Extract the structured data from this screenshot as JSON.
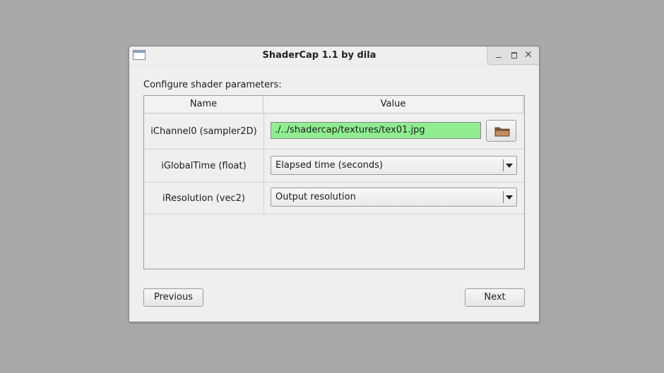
{
  "window": {
    "title": "ShaderCap 1.1 by dila",
    "close_glyph": "✕"
  },
  "main": {
    "instruction": "Configure shader parameters:",
    "table": {
      "headers": [
        "Name",
        "Value"
      ],
      "rows": [
        {
          "name": "iChannel0 (sampler2D)",
          "value": "./../shadercap/textures/tex01.jpg",
          "control": "file-path"
        },
        {
          "name": "iGlobalTime (float)",
          "value": "Elapsed time (seconds)",
          "control": "dropdown"
        },
        {
          "name": "iResolution (vec2)",
          "value": "Output resolution",
          "control": "dropdown"
        }
      ]
    }
  },
  "footer": {
    "previous_label": "Previous",
    "next_label": "Next"
  },
  "colors": {
    "path_field_bg": "#90ee90",
    "desktop_bg": "#a9a9a9",
    "window_bg": "#efefef"
  },
  "icons": {
    "window_icon": "window-icon",
    "browse_icon": "folder-icon",
    "minimize_icon": "minimize-icon",
    "maximize_icon": "maximize-icon",
    "close_icon": "close-icon",
    "dropdown_icon": "chevron-down-icon"
  }
}
